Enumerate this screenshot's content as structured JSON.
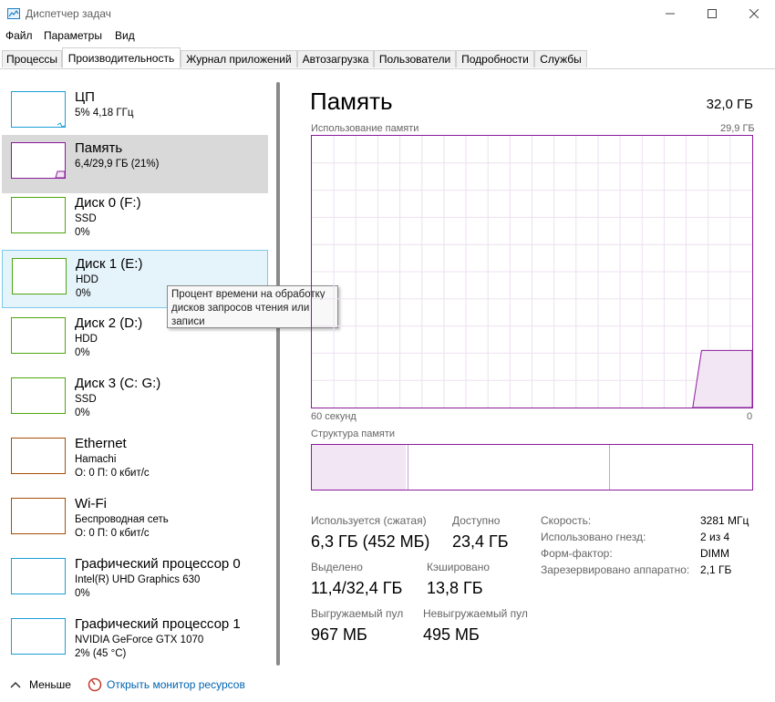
{
  "window": {
    "title": "Диспетчер задач"
  },
  "menu": [
    "Файл",
    "Параметры",
    "Вид"
  ],
  "tabs": [
    "Процессы",
    "Производительность",
    "Журнал приложений",
    "Автозагрузка",
    "Пользователи",
    "Подробности",
    "Службы"
  ],
  "devices": [
    {
      "name": "ЦП",
      "line1": "5% 4,18 ГГц",
      "line2": "",
      "color": "#1b9fd8"
    },
    {
      "name": "Память",
      "line1": "6,4/29,9 ГБ (21%)",
      "line2": "",
      "color": "#8b1a9b"
    },
    {
      "name": "Диск 0 (F:)",
      "line1": "SSD",
      "line2": "0%",
      "color": "#4da60c"
    },
    {
      "name": "Диск 1 (E:)",
      "line1": "HDD",
      "line2": "0%",
      "color": "#4da60c"
    },
    {
      "name": "Диск 2 (D:)",
      "line1": "HDD",
      "line2": "0%",
      "color": "#4da60c"
    },
    {
      "name": "Диск 3 (C: G:)",
      "line1": "SSD",
      "line2": "0%",
      "color": "#4da60c"
    },
    {
      "name": "Ethernet",
      "line1": "Hamachi",
      "line2": "О: 0 П: 0 кбит/с",
      "color": "#a74f01"
    },
    {
      "name": "Wi-Fi",
      "line1": "Беспроводная сеть",
      "line2": "О: 0 П: 0 кбит/с",
      "color": "#a74f01"
    },
    {
      "name": "Графический процессор 0",
      "line1": "Intel(R) UHD Graphics 630",
      "line2": "0%",
      "color": "#1b9fd8"
    },
    {
      "name": "Графический процессор 1",
      "line1": "NVIDIA GeForce GTX 1070",
      "line2": "2% (45 °C)",
      "color": "#1b9fd8"
    }
  ],
  "tooltip": "Процент времени на обработку дисков запросов чтения или записи",
  "memory": {
    "title": "Память",
    "total": "32,0 ГБ",
    "usage_label": "Использование памяти",
    "usage_max": "29,9 ГБ",
    "time_left": "60 секунд",
    "time_right": "0",
    "structure_label": "Структура памяти",
    "in_use_fraction": 0.21
  },
  "stats": {
    "in_use_label": "Используется (сжатая)",
    "in_use_value": "6,3 ГБ (452 МБ)",
    "available_label": "Доступно",
    "available_value": "23,4 ГБ",
    "committed_label": "Выделено",
    "committed_value": "11,4/32,4 ГБ",
    "cached_label": "Кэшировано",
    "cached_value": "13,8 ГБ",
    "paged_label": "Выгружаемый пул",
    "paged_value": "967 МБ",
    "nonpaged_label": "Невыгружаемый пул",
    "nonpaged_value": "495 МБ"
  },
  "specs": [
    {
      "label": "Скорость:",
      "value": "3281 МГц"
    },
    {
      "label": "Использовано гнезд:",
      "value": "2 из 4"
    },
    {
      "label": "Форм-фактор:",
      "value": "DIMM"
    },
    {
      "label": "Зарезервировано аппаратно:",
      "value": "2,1 ГБ"
    }
  ],
  "footer": {
    "fewer": "Меньше",
    "monitor": "Открыть монитор ресурсов"
  }
}
